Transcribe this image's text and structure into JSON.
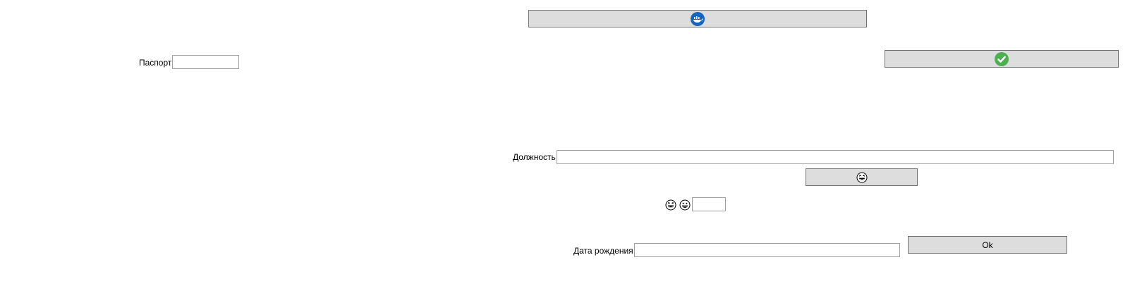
{
  "form": {
    "passport_label": "Паспорт",
    "passport_value": "",
    "position_label": "Должность",
    "position_value": "",
    "birthdate_label": "Дата рождения",
    "birthdate_value": "",
    "emoji_field_value": "",
    "ok_label": "Ok"
  },
  "icons": {
    "top_button": "steam-cup-icon",
    "confirm_button": "green-check-icon",
    "emoji_button": "laughing-face-icon",
    "emoji_left": "laughing-face-icon",
    "emoji_right": "grinning-face-icon"
  },
  "colors": {
    "button_bg": "#dddddd",
    "button_border": "#707070",
    "input_border": "#a0a0a0",
    "check_green": "#4caf50",
    "top_icon_blue": "#1565c0"
  }
}
